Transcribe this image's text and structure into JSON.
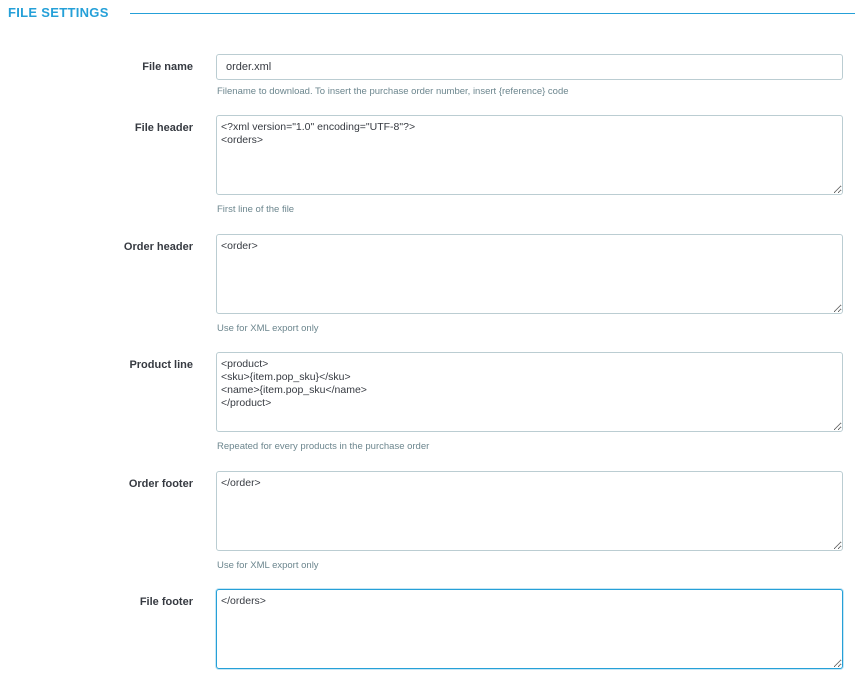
{
  "section": {
    "title": "FILE SETTINGS"
  },
  "colors": {
    "accent": "#25a0d8",
    "border": "#bbcdd2",
    "help_text": "#6c868e",
    "label_text": "#363a41"
  },
  "fields": {
    "file_name": {
      "label": "File name",
      "value": "order.xml",
      "help": "Filename to download. To insert the purchase order number, insert {reference} code"
    },
    "file_header": {
      "label": "File header",
      "value": "<?xml version=\"1.0\" encoding=\"UTF-8\"?>\n<orders>",
      "help": "First line of the file"
    },
    "order_header": {
      "label": "Order header",
      "value": "<order>",
      "help": "Use for XML export only"
    },
    "product_line": {
      "label": "Product line",
      "value": "<product>\n<sku>{item.pop_sku}</sku>\n<name>{item.pop_sku</name>\n</product>",
      "help": "Repeated for every products in the purchase order"
    },
    "order_footer": {
      "label": "Order footer",
      "value": "</order>",
      "help": "Use for XML export only"
    },
    "file_footer": {
      "label": "File footer",
      "value": "</orders>",
      "focused": true
    }
  }
}
